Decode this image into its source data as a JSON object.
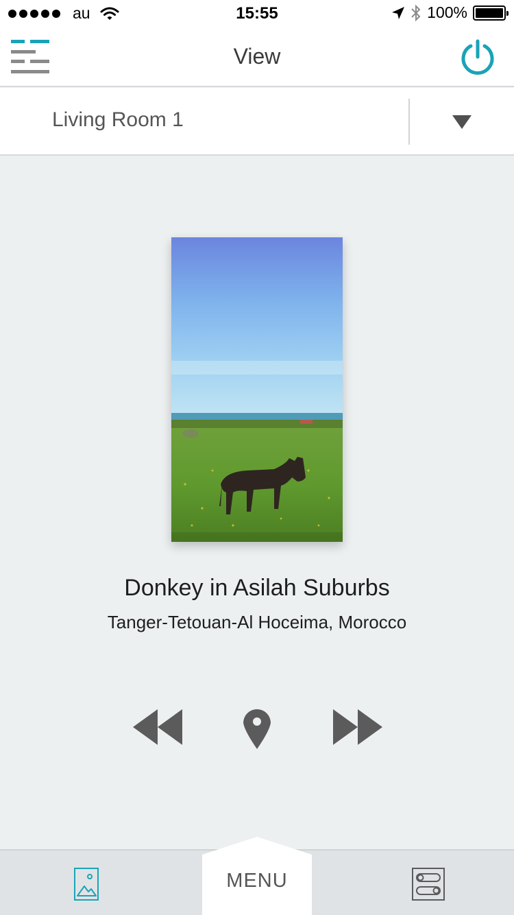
{
  "status_bar": {
    "carrier": "au",
    "time": "15:55",
    "battery_percent": "100%",
    "signal_dots": 5
  },
  "header": {
    "title": "View",
    "accent_color": "#1aa3b8",
    "menu_icon": "menu-icon",
    "power_icon": "power-icon"
  },
  "room_selector": {
    "selected_room": "Living Room 1",
    "dropdown_icon": "triangle-down-icon"
  },
  "photo": {
    "title": "Donkey in Asilah Suburbs",
    "location": "Tanger-Tetouan-Al Hoceima, Morocco"
  },
  "controls": {
    "previous_icon": "rewind-icon",
    "location_icon": "map-pin-icon",
    "next_icon": "fast-forward-icon"
  },
  "bottom_nav": {
    "menu_label": "MENU",
    "left_icon": "image-gallery-icon",
    "right_icon": "toggle-settings-icon"
  }
}
